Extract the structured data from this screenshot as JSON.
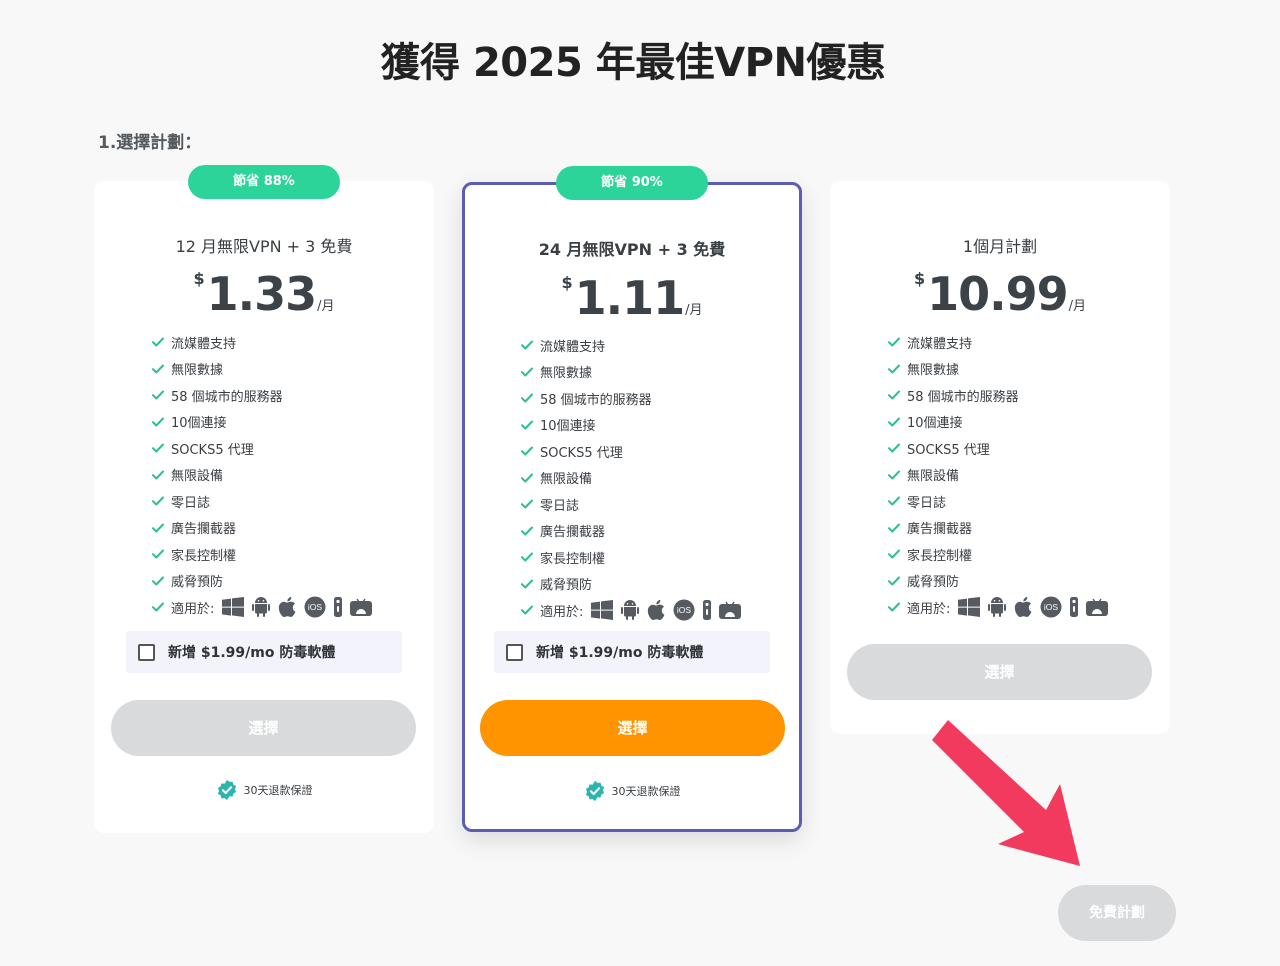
{
  "header": {
    "title": "獲得 2025 年最佳VPN優惠"
  },
  "step_label": "1.選擇計劃：",
  "plans": [
    {
      "badge": "節省 88%",
      "name": "12 月無限VPN + 3 免費",
      "currency": "$",
      "amount": "1.33",
      "per": "/月",
      "features": [
        "流媒體支持",
        "無限數據",
        "58 個城市的服務器",
        "10個連接",
        "SOCKS5 代理",
        "無限設備",
        "零日誌",
        "廣告攔截器",
        "家長控制權",
        "威脅預防",
        "適用於:"
      ],
      "addon": "新增 $1.99/mo 防毒軟體",
      "select": "選擇",
      "guarantee": "30天退款保證"
    },
    {
      "badge": "節省 90%",
      "name": "24 月無限VPN + 3 免費",
      "currency": "$",
      "amount": "1.11",
      "per": "/月",
      "features": [
        "流媒體支持",
        "無限數據",
        "58 個城市的服務器",
        "10個連接",
        "SOCKS5 代理",
        "無限設備",
        "零日誌",
        "廣告攔截器",
        "家長控制權",
        "威脅預防",
        "適用於:"
      ],
      "addon": "新增 $1.99/mo 防毒軟體",
      "select": "選擇",
      "guarantee": "30天退款保證"
    },
    {
      "name": "1個月計劃",
      "currency": "$",
      "amount": "10.99",
      "per": "/月",
      "features": [
        "流媒體支持",
        "無限數據",
        "58 個城市的服務器",
        "10個連接",
        "SOCKS5 代理",
        "無限設備",
        "零日誌",
        "廣告攔截器",
        "家長控制權",
        "威脅預防",
        "適用於:"
      ],
      "select": "選擇"
    }
  ],
  "platform_icons": [
    "windows-icon",
    "android-icon",
    "apple-icon",
    "ios-icon",
    "fire-tv-icon",
    "android-tv-icon"
  ],
  "ios_text": "iOS",
  "free_plan": "免費計劃",
  "colors": {
    "save_badge": "#2cd49a",
    "highlight_border": "#5b5db0",
    "primary_button": "#ff9300",
    "disabled_button": "#d8dadb",
    "check": "#2cc08a",
    "arrow": "#f23a5e"
  }
}
